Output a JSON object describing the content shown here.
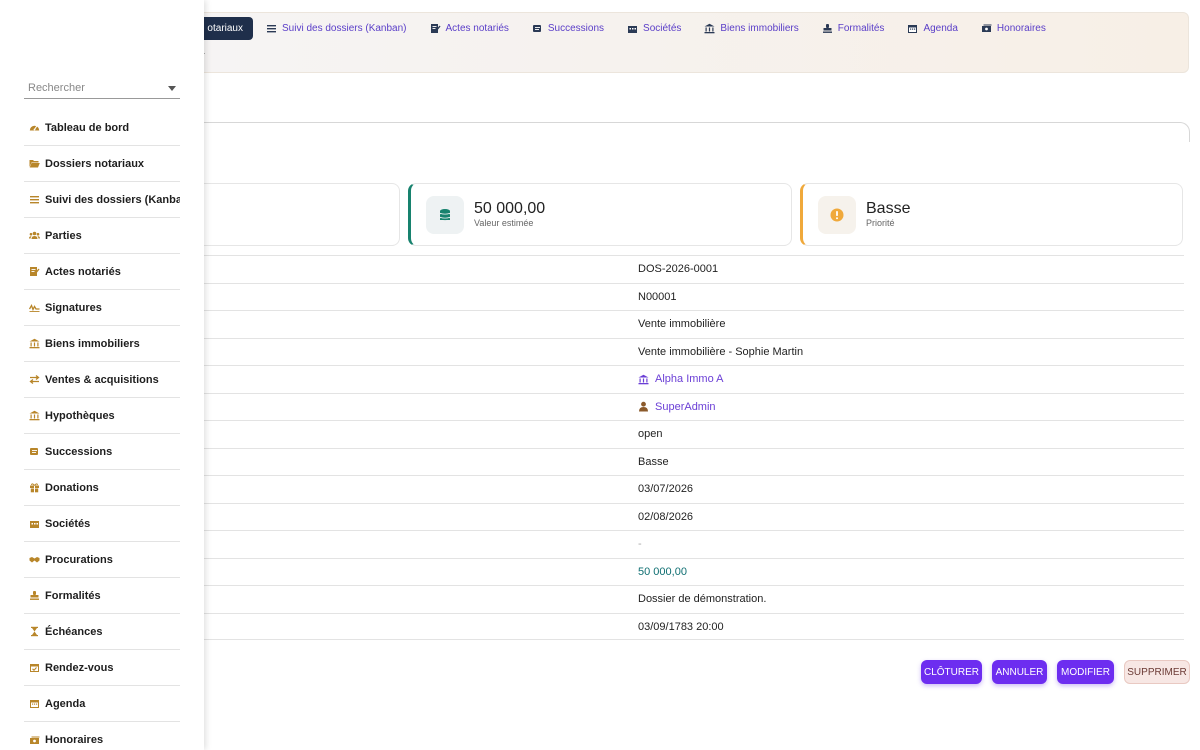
{
  "topnav": {
    "active_label": "otariaux",
    "items": [
      {
        "label": "Suivi des dossiers (Kanban)",
        "icon": "list-icon"
      },
      {
        "label": "Actes notariés",
        "icon": "signature-icon"
      },
      {
        "label": "Successions",
        "icon": "scroll-icon"
      },
      {
        "label": "Sociétés",
        "icon": "industry-icon"
      },
      {
        "label": "Biens immobiliers",
        "icon": "landmark-icon"
      },
      {
        "label": "Formalités",
        "icon": "stamp-icon"
      },
      {
        "label": "Agenda",
        "icon": "calendar-icon"
      },
      {
        "label": "Honoraires",
        "icon": "money-bill-icon"
      }
    ]
  },
  "cards": {
    "value": {
      "amount": "50 000,00",
      "label": "Valeur estimée",
      "icon": "coins-icon",
      "accent": "#17826e"
    },
    "priority": {
      "amount": "Basse",
      "label": "Priorité",
      "icon": "exclamation-icon",
      "accent": "#f0a93b"
    }
  },
  "details": {
    "reference": "DOS-2026-0001",
    "number": "N00001",
    "type": "Vente immobilière",
    "title": "Vente immobilière - Sophie Martin",
    "company": "Alpha Immo A",
    "owner": "SuperAdmin",
    "status": "open",
    "priority": "Basse",
    "date_open": "03/07/2026",
    "date_due": "02/08/2026",
    "empty": "-",
    "amount": "50 000,00",
    "note": "Dossier de démonstration.",
    "created": "03/09/1783 20:00"
  },
  "actions": {
    "close": "CLÔTURER",
    "cancel": "ANNULER",
    "edit": "MODIFIER",
    "delete": "SUPPRIMER"
  },
  "sidebar": {
    "search_placeholder": "Rechercher",
    "items": [
      {
        "label": "Tableau de bord",
        "icon": "tachometer-icon"
      },
      {
        "label": "Dossiers notariaux",
        "icon": "folder-open-icon"
      },
      {
        "label": "Suivi des dossiers (Kanban)",
        "icon": "list-icon"
      },
      {
        "label": "Parties",
        "icon": "users-icon"
      },
      {
        "label": "Actes notariés",
        "icon": "signature-icon"
      },
      {
        "label": "Signatures",
        "icon": "signature-line-icon"
      },
      {
        "label": "Biens immobiliers",
        "icon": "landmark-icon"
      },
      {
        "label": "Ventes & acquisitions",
        "icon": "exchange-icon"
      },
      {
        "label": "Hypothèques",
        "icon": "landmark-icon"
      },
      {
        "label": "Successions",
        "icon": "scroll-icon"
      },
      {
        "label": "Donations",
        "icon": "gift-icon"
      },
      {
        "label": "Sociétés",
        "icon": "industry-icon"
      },
      {
        "label": "Procurations",
        "icon": "handshake-icon"
      },
      {
        "label": "Formalités",
        "icon": "stamp-icon"
      },
      {
        "label": "Échéances",
        "icon": "hourglass-icon"
      },
      {
        "label": "Rendez-vous",
        "icon": "calendar-check-icon"
      },
      {
        "label": "Agenda",
        "icon": "calendar-icon"
      },
      {
        "label": "Honoraires",
        "icon": "money-bill-icon"
      }
    ]
  }
}
